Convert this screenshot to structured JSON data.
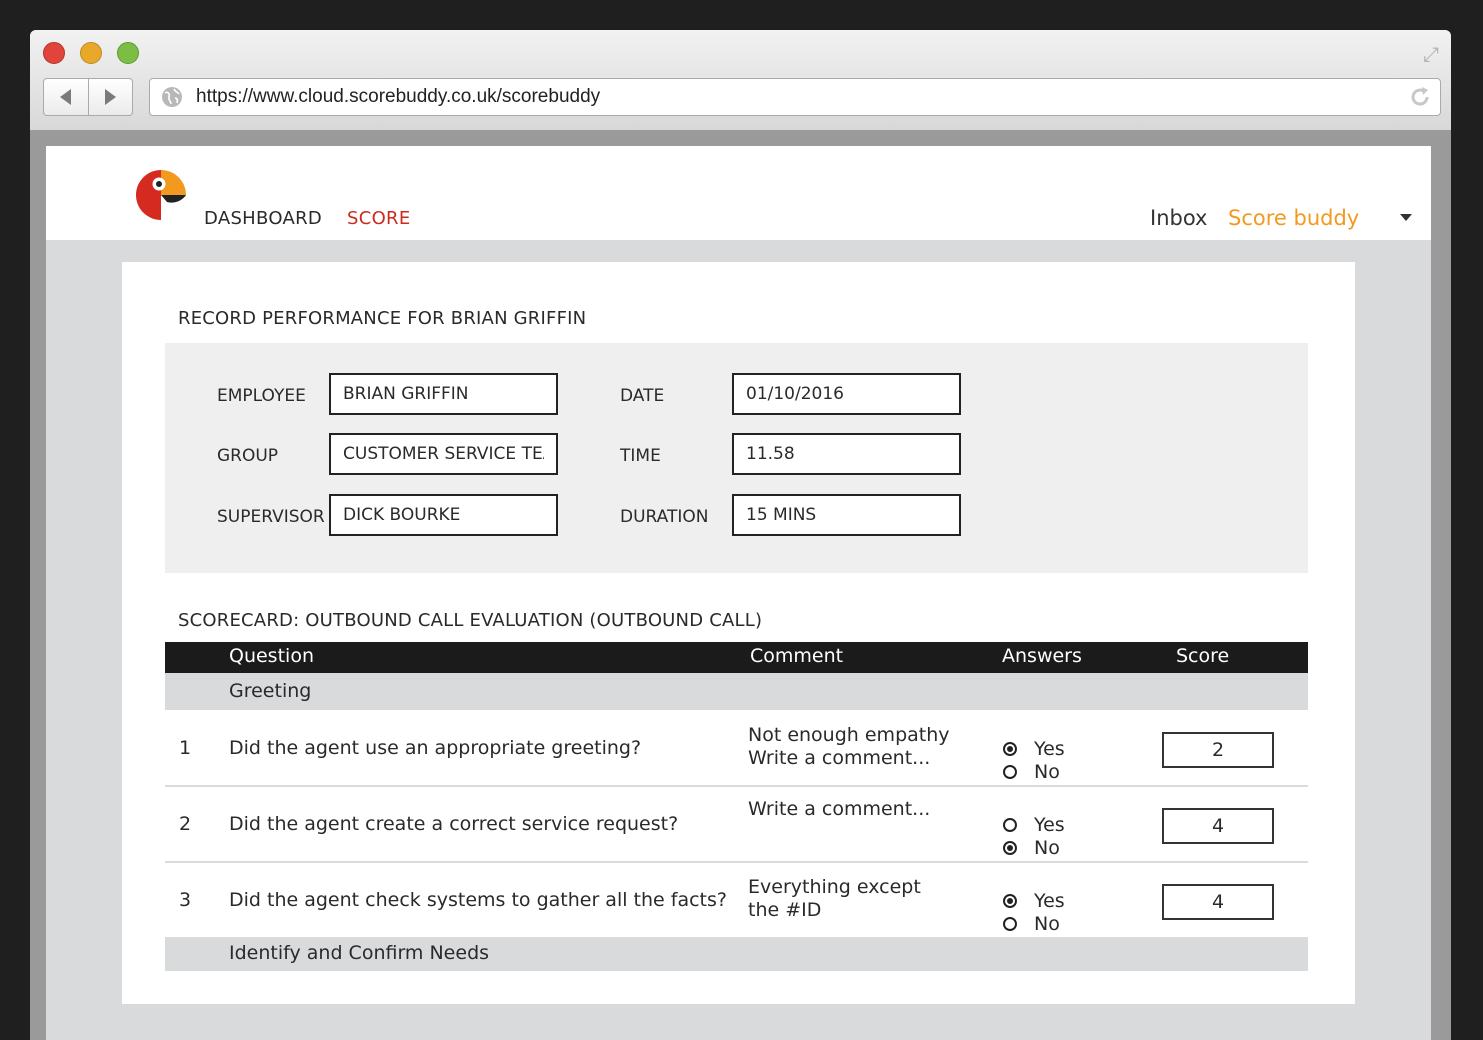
{
  "browser": {
    "url": "https://www.cloud.scorebuddy.co.uk/scorebuddy"
  },
  "nav": {
    "dashboard": "DASHBOARD",
    "score": "SCORE",
    "inbox": "Inbox",
    "user": "Score buddy"
  },
  "colors": {
    "accent_red": "#cc2a1e",
    "accent_orange": "#f29a1f",
    "header_dark": "#1b1b1b"
  },
  "form": {
    "title": "RECORD PERFORMANCE FOR BRIAN GRIFFIN",
    "employee_label": "EMPLOYEE",
    "employee_value": "BRIAN GRIFFIN",
    "group_label": "GROUP",
    "group_value": "CUSTOMER SERVICE TEA",
    "supervisor_label": "SUPERVISOR",
    "supervisor_value": "DICK BOURKE",
    "date_label": "DATE",
    "date_value": "01/10/2016",
    "time_label": "TIME",
    "time_value": "11.58",
    "duration_label": "DURATION",
    "duration_value": "15 MINS"
  },
  "scorecard": {
    "title": "SCORECARD: OUTBOUND CALL EVALUATION (OUTBOUND CALL)",
    "headers": {
      "question": "Question",
      "comment": "Comment",
      "answers": "Answers",
      "score": "Score"
    },
    "sections": [
      "Greeting",
      "Identify and Confirm Needs"
    ],
    "yes_label": "Yes",
    "no_label": "No",
    "rows": [
      {
        "num": "1",
        "question": "Did the agent use an appropriate greeting?",
        "comment_line1": "Not enough empathy",
        "comment_line2": "Write a comment...",
        "answer": "Yes",
        "score": "2"
      },
      {
        "num": "2",
        "question": "Did the agent create a correct service request?",
        "comment_line1": "Write a comment...",
        "comment_line2": "",
        "answer": "No",
        "score": "4"
      },
      {
        "num": "3",
        "question": "Did the agent check systems to gather all the facts?",
        "comment_line1": "Everything except",
        "comment_line2": "the #ID",
        "answer": "Yes",
        "score": "4"
      }
    ]
  }
}
